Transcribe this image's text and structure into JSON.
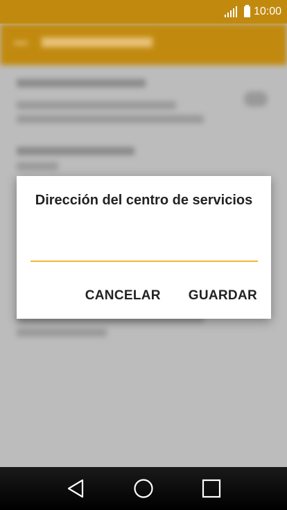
{
  "status_bar": {
    "time": "10:00",
    "icons": [
      "signal-icon",
      "battery-icon"
    ]
  },
  "dialog": {
    "title": "Dirección del centro de servicios",
    "input_value": "",
    "cancel_label": "CANCELAR",
    "save_label": "GUARDAR",
    "accent_color": "#f5b52c"
  },
  "nav_bar": {
    "icons": [
      "back-triangle-icon",
      "home-circle-icon",
      "recents-square-icon"
    ]
  },
  "colors": {
    "primary": "#c18a0f",
    "scrim_background": "#bdbdbd"
  }
}
